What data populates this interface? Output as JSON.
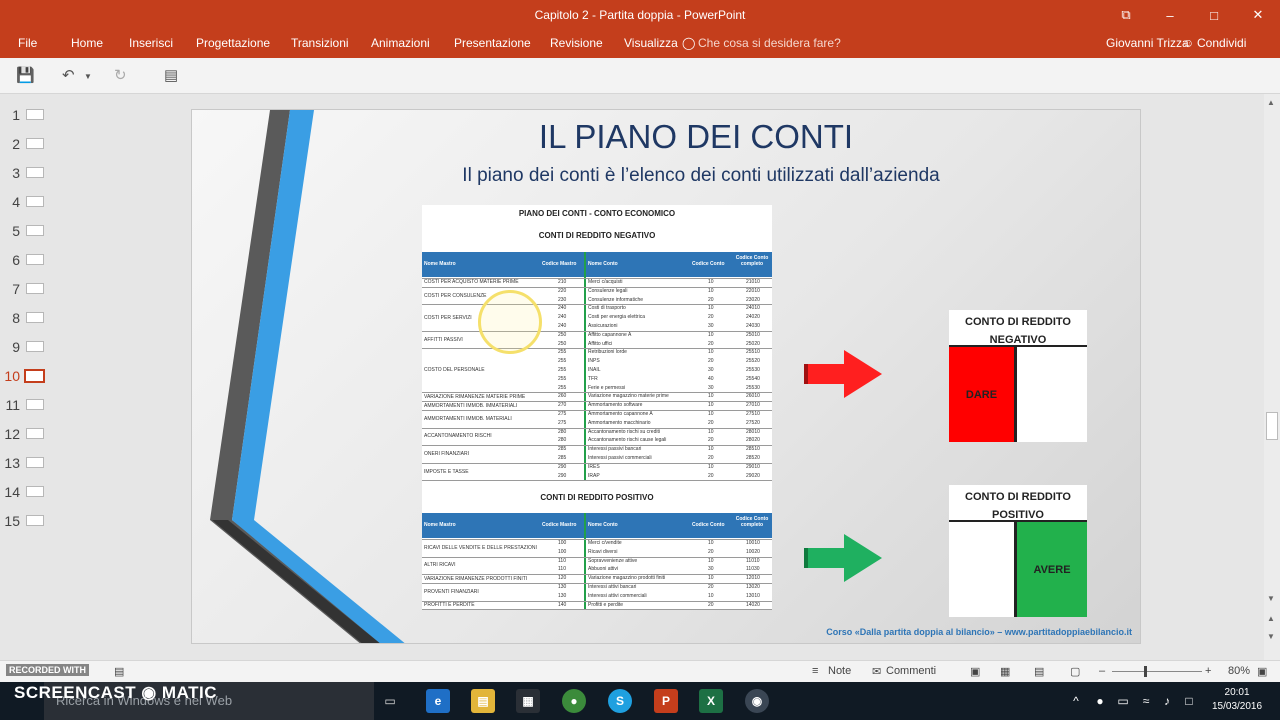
{
  "window": {
    "title": "Capitolo 2 - Partita doppia - PowerPoint",
    "buttons": [
      "⧉",
      "–",
      "□",
      "✕"
    ]
  },
  "ribbon": {
    "tabs": [
      "File",
      "Home",
      "Inserisci",
      "Progettazione",
      "Transizioni",
      "Animazioni",
      "Presentazione",
      "Revisione",
      "Visualizza"
    ],
    "help": "Che cosa si desidera fare?",
    "user": "Giovanni Trizza",
    "share": "Condividi"
  },
  "slides_panel": {
    "numbers": [
      "1",
      "2",
      "3",
      "4",
      "5",
      "6",
      "7",
      "8",
      "9",
      "10",
      "11",
      "12",
      "13",
      "14",
      "15"
    ],
    "active_index": 10
  },
  "slide": {
    "title": "IL PIANO DEI CONTI",
    "subtitle": "Il piano dei conti è l’elenco dei conti utilizzati dall’azienda",
    "doc_title": "PIANO DEI CONTI - CONTO ECONOMICO",
    "section_negative": "CONTI DI REDDITO NEGATIVO",
    "section_positive": "CONTI DI REDDITO POSITIVO",
    "table_headers": [
      "Nome Mastro",
      "Codice Mastro",
      "Nome Conto",
      "Codice Conto",
      "Codice Conto completo"
    ],
    "negative_mastri": [
      "COSTI PER ACQUISTO MATERIE PRIME",
      "COSTI PER CONSULENZE",
      "COSTI PER SERVIZI",
      "AFFITTI PASSIVI",
      "COSTO DEL PERSONALE",
      "VARIAZIONE RIMANENZE MATERIE PRIME",
      "AMMORTAMENTI IMMOB. IMMATERIALI",
      "AMMORTAMENTI IMMOB. MATERIALI",
      "ACCANTONAMENTO RISCHI",
      "ONERI FINANZIARI",
      "IMPOSTE E TASSE"
    ],
    "negative_rows": [
      {
        "cm": "210",
        "conto": "Merci c/acquisti",
        "cc": "10",
        "full": "21010"
      },
      {
        "cm": "220",
        "conto": "Consulenze legali",
        "cc": "10",
        "full": "22010"
      },
      {
        "cm": "230",
        "conto": "Consulenze informatiche",
        "cc": "20",
        "full": "23020"
      },
      {
        "cm": "240",
        "conto": "Costi di trasporto",
        "cc": "10",
        "full": "24010"
      },
      {
        "cm": "240",
        "conto": "Costi per energia elettrica",
        "cc": "20",
        "full": "24020"
      },
      {
        "cm": "240",
        "conto": "Assicurazioni",
        "cc": "30",
        "full": "24030"
      },
      {
        "cm": "250",
        "conto": "Affitto capannone A",
        "cc": "10",
        "full": "25010"
      },
      {
        "cm": "250",
        "conto": "Affitto uffici",
        "cc": "20",
        "full": "25020"
      },
      {
        "cm": "255",
        "conto": "Retribuzioni lorde",
        "cc": "10",
        "full": "25510"
      },
      {
        "cm": "255",
        "conto": "INPS",
        "cc": "20",
        "full": "25520"
      },
      {
        "cm": "255",
        "conto": "INAIL",
        "cc": "30",
        "full": "25530"
      },
      {
        "cm": "255",
        "conto": "TFR",
        "cc": "40",
        "full": "25540"
      },
      {
        "cm": "255",
        "conto": "Ferie e permessi",
        "cc": "30",
        "full": "25530"
      },
      {
        "cm": "260",
        "conto": "Variazione magazzino materie prime",
        "cc": "10",
        "full": "26010"
      },
      {
        "cm": "270",
        "conto": "Ammortamento software",
        "cc": "10",
        "full": "27010"
      },
      {
        "cm": "275",
        "conto": "Ammortamento capannone A",
        "cc": "10",
        "full": "27510"
      },
      {
        "cm": "275",
        "conto": "Ammortamento macchinario",
        "cc": "20",
        "full": "27520"
      },
      {
        "cm": "280",
        "conto": "Accantonamento rischi su crediti",
        "cc": "10",
        "full": "28010"
      },
      {
        "cm": "280",
        "conto": "Accantonamento rischi cause legali",
        "cc": "20",
        "full": "28020"
      },
      {
        "cm": "285",
        "conto": "Interessi passivi bancari",
        "cc": "10",
        "full": "28510"
      },
      {
        "cm": "285",
        "conto": "Interessi passivi commerciali",
        "cc": "20",
        "full": "28520"
      },
      {
        "cm": "290",
        "conto": "IRES",
        "cc": "10",
        "full": "29010"
      },
      {
        "cm": "290",
        "conto": "IRAP",
        "cc": "20",
        "full": "29020"
      }
    ],
    "positive_mastri": [
      "RICAVI DELLE VENDITE E DELLE PRESTAZIONI",
      "ALTRI RICAVI",
      "VARIAZIONE RIMANENZE PRODOTTI FINITI",
      "PROVENTI FINANZIARI",
      "PROFITTI E PERDITE"
    ],
    "positive_rows": [
      {
        "cm": "100",
        "conto": "Merci c/vendite",
        "cc": "10",
        "full": "10010"
      },
      {
        "cm": "100",
        "conto": "Ricavi diversi",
        "cc": "20",
        "full": "10020"
      },
      {
        "cm": "110",
        "conto": "Sopravvenienze attive",
        "cc": "10",
        "full": "11010"
      },
      {
        "cm": "110",
        "conto": "Abbuoni attivi",
        "cc": "30",
        "full": "11030"
      },
      {
        "cm": "120",
        "conto": "Variazione magazzino prodotti finiti",
        "cc": "10",
        "full": "12010"
      },
      {
        "cm": "130",
        "conto": "Interessi attivi bancari",
        "cc": "20",
        "full": "13020"
      },
      {
        "cm": "130",
        "conto": "Interessi attivi commerciali",
        "cc": "10",
        "full": "13010"
      },
      {
        "cm": "140",
        "conto": "Profitti e perdite",
        "cc": "20",
        "full": "14020"
      }
    ],
    "box_negative": {
      "title": "CONTO DI REDDITO NEGATIVO",
      "label": "DARE",
      "color": "#ff0000"
    },
    "box_positive": {
      "title": "CONTO DI REDDITO POSITIVO",
      "label": "AVERE",
      "color": "#22b14c"
    },
    "footer": "Corso «Dalla partita doppia al bilancio» – www.partitadoppiaebilancio.it"
  },
  "statusbar": {
    "note": "Note",
    "comments": "Commenti",
    "zoom": "80%"
  },
  "watermark": {
    "recorded": "RECORDED WITH",
    "brand": "SCREENCAST ◉ MATIC"
  },
  "taskbar": {
    "search_placeholder": "Ricerca in Windows e nel Web",
    "time": "20:01",
    "date": "15/03/2016"
  },
  "colors": {
    "accent": "#c43e1c",
    "title_blue": "#1f3864",
    "table_blue": "#2e75b6"
  }
}
